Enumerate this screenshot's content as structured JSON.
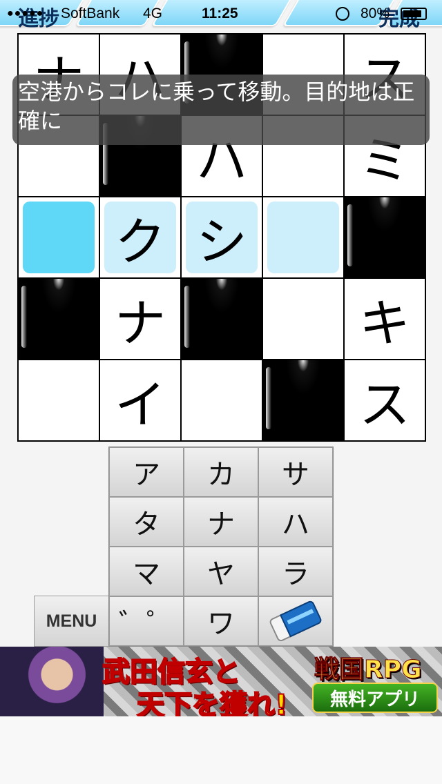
{
  "status_bar": {
    "signal": "●●●●●",
    "carrier": "SoftBank",
    "network": "4G",
    "time": "11:25",
    "battery": "80%"
  },
  "tabs": {
    "progress": "進捗",
    "complete": "完成"
  },
  "grid": {
    "rows": [
      [
        {
          "char": "ナ"
        },
        {
          "char": "ハ"
        },
        {
          "black": true
        },
        {
          "char": ""
        },
        {
          "char": "ス"
        }
      ],
      [
        {
          "char": ""
        },
        {
          "black": true
        },
        {
          "char": "ハ"
        },
        {
          "char": ""
        },
        {
          "char": "ミ"
        }
      ],
      [
        {
          "char": "",
          "active": true,
          "cursor": true
        },
        {
          "char": "ク",
          "active": true
        },
        {
          "char": "シ",
          "active": true
        },
        {
          "char": "",
          "active": true
        },
        {
          "black": true
        }
      ],
      [
        {
          "black": true
        },
        {
          "char": "ナ"
        },
        {
          "black": true
        },
        {
          "char": ""
        },
        {
          "char": "キ"
        }
      ],
      [
        {
          "char": ""
        },
        {
          "char": "イ"
        },
        {
          "char": ""
        },
        {
          "black": true
        },
        {
          "char": "ス"
        }
      ]
    ]
  },
  "clue": {
    "text": "空港からコレに乗って移動。目的地は正確に"
  },
  "keyboard": {
    "keys": [
      "ア",
      "カ",
      "サ",
      "タ",
      "ナ",
      "ハ",
      "マ",
      "ヤ",
      "ラ",
      "゛゜",
      "ワ",
      ""
    ],
    "menu_label": "MENU"
  },
  "ad": {
    "line1": "武田信玄と",
    "line2": "天下を獲れ!",
    "title": "戦国RPG",
    "button": "無料アプリ"
  }
}
